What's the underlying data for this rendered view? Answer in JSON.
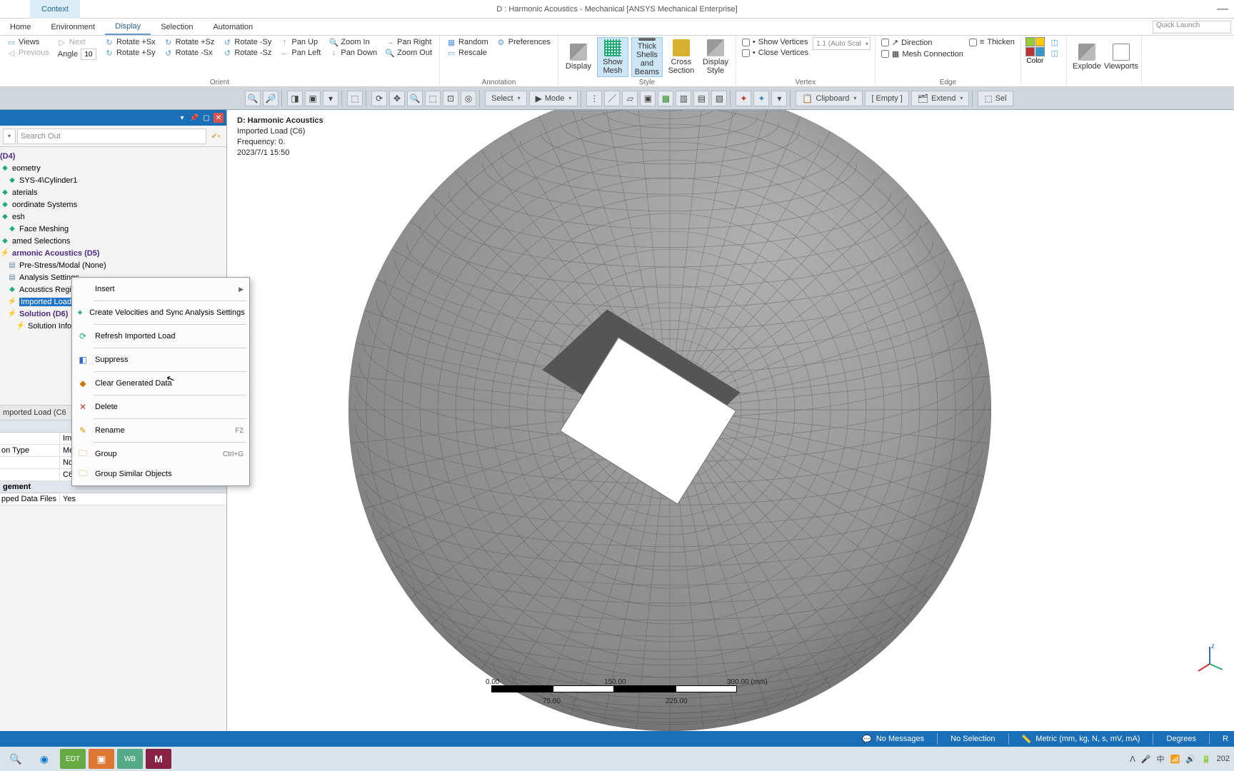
{
  "window": {
    "title": "D : Harmonic Acoustics - Mechanical [ANSYS Mechanical Enterprise]",
    "context_tab": "Context",
    "quick_launch": "Quick Launch"
  },
  "menu": {
    "home": "Home",
    "environment": "Environment",
    "display": "Display",
    "selection": "Selection",
    "automation": "Automation"
  },
  "ribbon": {
    "views": "Views",
    "next": "Next",
    "previous": "Previous",
    "angle_label": "Angle",
    "angle_value": "10",
    "rot_px": "Rotate +Sx",
    "rot_pz": "Rotate +Sz",
    "rot_my": "Rotate -Sy",
    "rot_py": "Rotate +Sy",
    "rot_mx": "Rotate -Sx",
    "rot_mz": "Rotate -Sz",
    "pan_up": "Pan Up",
    "pan_left": "Pan Left",
    "zoom_in": "Zoom In",
    "pan_right": "Pan Right",
    "pan_down": "Pan Down",
    "zoom_out": "Zoom Out",
    "orient_label": "Orient",
    "random": "Random",
    "preferences": "Preferences",
    "rescale": "Rescale",
    "annotation_label": "Annotation",
    "display": "Display",
    "show_mesh": "Show Mesh",
    "thick": "Thick Shells and Beams",
    "cross": "Cross Section",
    "disp_style": "Display Style",
    "style_label": "Style",
    "show_vert": "Show Vertices",
    "close_vert": "Close Vertices",
    "auto_scale": "1.1 (Auto Scal",
    "vertex_label": "Vertex",
    "direction": "Direction",
    "mesh_conn": "Mesh Connection",
    "thicken": "Thicken",
    "edge_label": "Edge",
    "color": "Color",
    "explode": "Explode",
    "viewports": "Viewports"
  },
  "toolbar": {
    "select": "Select",
    "mode": "Mode",
    "clipboard": "Clipboard",
    "empty": "[ Empty ]",
    "extend": "Extend",
    "sel": "Sel"
  },
  "tree": {
    "search_placeholder": "Search Out",
    "n_model": "(D4)",
    "n_geom": "eometry",
    "n_cyl": "SYS-4\\Cylinder1",
    "n_mat": "aterials",
    "n_coord": "oordinate Systems",
    "n_mesh": "esh",
    "n_face": "Face Meshing",
    "n_named": "amed Selections",
    "n_harm": "armonic Acoustics (D5)",
    "n_prestress": "Pre-Stress/Modal (None)",
    "n_settings": "Analysis Settings",
    "n_region": "Acoustics Region",
    "n_imported": "Imported Load (C",
    "n_solution": "Solution (D6)",
    "n_solinfo": "Solution Infor"
  },
  "details": {
    "header": "mported Load (C6",
    "row1k": "",
    "row1v": "Im",
    "row2k": "on Type",
    "row2v": "Me",
    "row3k": "",
    "row3v": "No",
    "row4k": "",
    "row4v": "C6",
    "cat2": "gement",
    "row5k": "pped Data Files",
    "row5v": "Yes"
  },
  "ctx": {
    "insert": "Insert",
    "create_vel": "Create Velocities and Sync Analysis Settings",
    "refresh": "Refresh Imported Load",
    "suppress": "Suppress",
    "clear": "Clear Generated Data",
    "delete": "Delete",
    "rename": "Rename",
    "rename_sc": "F2",
    "group": "Group",
    "group_sc": "Ctrl+G",
    "group_sim": "Group Similar Objects"
  },
  "overlay": {
    "l1": "D: Harmonic Acoustics",
    "l2": "Imported Load (C6)",
    "l3": "Frequency: 0.",
    "l4": "2023/7/1 15:50"
  },
  "scale": {
    "v0": "0.00",
    "v1": "150.00",
    "v2": "300.00 (mm)",
    "m1": "75.00",
    "m2": "225.00"
  },
  "triad": {
    "z": "z"
  },
  "status": {
    "msg": "No Messages",
    "sel": "No Selection",
    "units": "Metric (mm, kg, N, s, mV, mA)",
    "deg": "Degrees",
    "r": "R"
  },
  "systray": {
    "ime": "中",
    "time_suffix": "202"
  }
}
